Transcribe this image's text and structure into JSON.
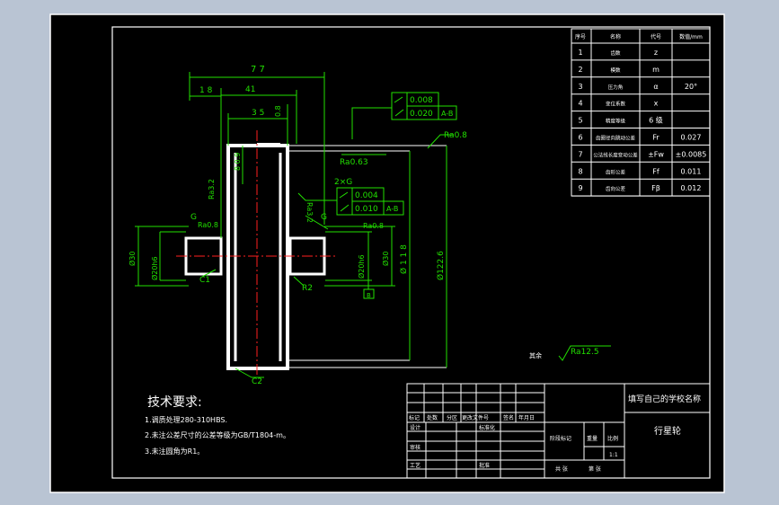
{
  "dimensions": {
    "overall_length": "7 7",
    "offset_left": "1 8",
    "offset_inner": "41",
    "hub_width": "3 5",
    "top_small": "0.8",
    "v_left_a": "Ø30",
    "v_left_b": "Ø20h6",
    "v_right_a": "Ø20h6",
    "v_right_b": "Ø30",
    "v_mid_bore": "8 0.9",
    "v_outer_a": "Ø 1 1 8",
    "v_outer_b": "Ø122.6"
  },
  "tolerances": {
    "top": [
      {
        "value": "0.008"
      },
      {
        "value": "0.020",
        "ref": "A-B"
      }
    ],
    "mid": [
      {
        "value": "0.004"
      },
      {
        "value": "0.010",
        "ref": "A-B"
      }
    ],
    "mid_label": "2×G"
  },
  "roughness": {
    "top_right": "Ra0.8",
    "mid_top": "Ra0.63",
    "left_vert": "Ra3.2",
    "left_g": "Ra0.8",
    "right_vert": "Ra3.2",
    "right_g": "Ra0.8",
    "remaining_label": "其余",
    "remaining": "Ra12.5"
  },
  "labels": {
    "g_left": "G",
    "g_right": "G",
    "c1": "C1",
    "r2": "R2",
    "c2": "C2",
    "datum": "B"
  },
  "params_table": {
    "headers": [
      "序号",
      "名称",
      "代号",
      "数值/mm"
    ],
    "rows": [
      [
        "1",
        "齿数",
        "z",
        ""
      ],
      [
        "2",
        "模数",
        "m",
        ""
      ],
      [
        "3",
        "压力角",
        "α",
        "20°"
      ],
      [
        "4",
        "变位系数",
        "x",
        ""
      ],
      [
        "5",
        "精度等级",
        "6 级",
        ""
      ],
      [
        "6",
        "齿圈径向跳动公差",
        "Fr",
        "0.027"
      ],
      [
        "7",
        "公法线长度变动公差",
        "±Fw",
        "±0.0085"
      ],
      [
        "8",
        "齿形公差",
        "Ff",
        "0.011"
      ],
      [
        "9",
        "齿向公差",
        "Fβ",
        "0.012"
      ]
    ]
  },
  "requirements": {
    "title": "技术要求:",
    "items": [
      "1.调质处理280-310HBS.",
      "2.未注公差尺寸的公差等级为GB/T1804-m。",
      "3.未注圆角为R1。"
    ]
  },
  "title_block": {
    "header_row": [
      "标记",
      "处数",
      "分区",
      "更改文件号",
      "签名",
      "年月日"
    ],
    "design": "设计",
    "standardize": "标准化",
    "check": "审核",
    "process": "工艺",
    "approve": "批准",
    "stage_mark": "阶段标记",
    "weight": "重量",
    "scale": "比例",
    "scale_value": "1:1",
    "sheets": "共 张",
    "sheet_no": "第 张",
    "school": "填写自己的学校名称",
    "part_name": "行星轮"
  }
}
